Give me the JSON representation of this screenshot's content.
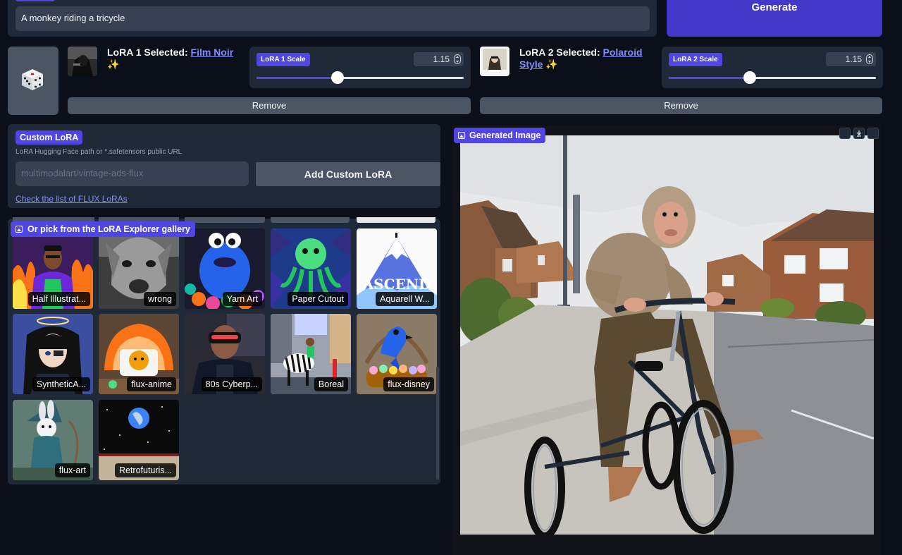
{
  "prompt": {
    "value": "A monkey riding a tricycle"
  },
  "generate": {
    "label": "Generate"
  },
  "lora1": {
    "prefix": "LoRA 1 Selected: ",
    "name": "Film Noir",
    "suffix": " ✨",
    "scale_label": "LoRA 1 Scale",
    "scale_value": "1.15",
    "slider_fraction": 0.39,
    "remove_label": "Remove"
  },
  "lora2": {
    "prefix": "LoRA 2 Selected: ",
    "name": "Polaroid Style",
    "suffix": " ✨",
    "scale_label": "LoRA 2 Scale",
    "scale_value": "1.15",
    "slider_fraction": 0.39,
    "remove_label": "Remove"
  },
  "custom_lora": {
    "title": "Custom LoRA",
    "help": "LoRA Hugging Face path or *.safetensors public URL",
    "placeholder": "multimodalart/vintage-ads-flux",
    "add_label": "Add Custom LoRA",
    "link": "Check the list of FLUX LoRAs"
  },
  "gallery": {
    "title": "Or pick from the LoRA Explorer gallery",
    "items": [
      {
        "label": "Half Illustrat..."
      },
      {
        "label": "wrong"
      },
      {
        "label": "Yarn Art"
      },
      {
        "label": "Paper Cutout"
      },
      {
        "label": "Aquarell W..."
      },
      {
        "label": "SyntheticA..."
      },
      {
        "label": "flux-anime"
      },
      {
        "label": "80s Cyberp..."
      },
      {
        "label": "Boreal"
      },
      {
        "label": "flux-disney"
      },
      {
        "label": "flux-art"
      },
      {
        "label": "Retrofuturis..."
      }
    ],
    "tile5_text": "ASCEND"
  },
  "generated": {
    "title": "Generated Image"
  },
  "colors": {
    "accent": "#4f46e5",
    "background": "#0b0f19",
    "panel": "#1f2937",
    "link": "#818cf8"
  }
}
